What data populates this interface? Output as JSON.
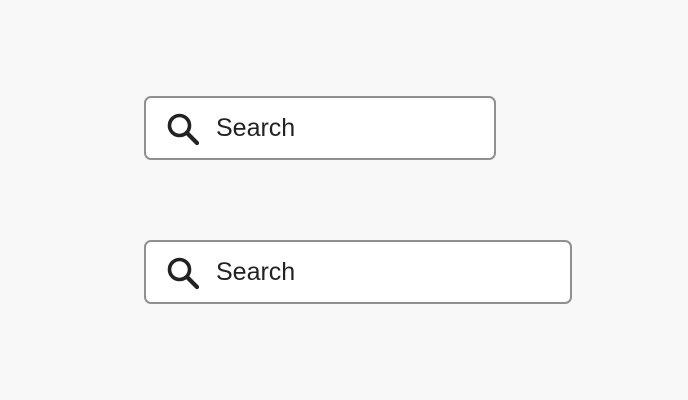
{
  "search_fields": [
    {
      "placeholder": "Search",
      "icon": "search-icon"
    },
    {
      "placeholder": "Search",
      "icon": "search-icon"
    }
  ],
  "colors": {
    "background": "#f8f8f8",
    "field_background": "#ffffff",
    "border": "#909090",
    "text": "#222222",
    "icon": "#222222"
  }
}
